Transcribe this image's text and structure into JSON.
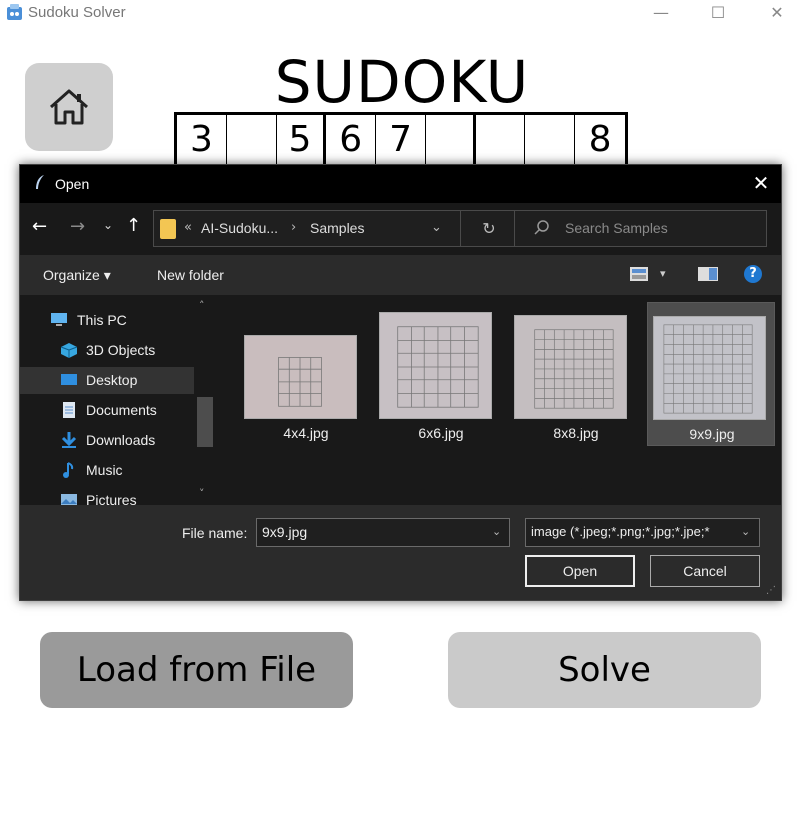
{
  "window": {
    "title": "Sudoku Solver",
    "minimize_glyph": "—",
    "maximize_glyph": "☐",
    "close_glyph": "✕"
  },
  "app": {
    "heading": "SUDOKU",
    "grid_row": [
      "3",
      "",
      "5",
      "6",
      "7",
      "",
      "",
      "",
      "8"
    ],
    "load_button": "Load from File",
    "solve_button": "Solve"
  },
  "dialog": {
    "title": "Open",
    "close_glyph": "✕",
    "nav": {
      "back_glyph": "←",
      "forward_glyph": "→",
      "recent_glyph": "⌄",
      "up_glyph": "↑"
    },
    "address": {
      "overflow_glyph": "«",
      "segment1": "AI-Sudoku...",
      "separator": "›",
      "segment2": "Samples",
      "dropdown_glyph": "⌄",
      "refresh_glyph": "↻"
    },
    "search": {
      "placeholder": "Search Samples"
    },
    "toolbar": {
      "organize": "Organize ▾",
      "new_folder": "New folder",
      "view_dropdown": "▾",
      "help": "?"
    },
    "nav_pane": {
      "items": [
        {
          "label": "This PC",
          "icon": "pc-icon"
        },
        {
          "label": "3D Objects",
          "icon": "cube-icon"
        },
        {
          "label": "Desktop",
          "icon": "desktop-icon",
          "selected": true
        },
        {
          "label": "Documents",
          "icon": "document-icon"
        },
        {
          "label": "Downloads",
          "icon": "download-icon"
        },
        {
          "label": "Music",
          "icon": "music-icon"
        },
        {
          "label": "Pictures",
          "icon": "pictures-icon"
        }
      ],
      "scroll_up": "˄",
      "scroll_down": "˅"
    },
    "files": [
      {
        "name": "4x4.jpg"
      },
      {
        "name": "6x6.jpg"
      },
      {
        "name": "8x8.jpg"
      },
      {
        "name": "9x9.jpg",
        "selected": true
      }
    ],
    "file_name_label": "File name:",
    "file_name_value": "9x9.jpg",
    "file_name_dropdown": "⌄",
    "file_type": "image (*.jpeg;*.png;*.jpg;*.jpe;*",
    "file_type_dropdown": "⌄",
    "open_button": "Open",
    "cancel_button": "Cancel",
    "resize_grip": "⋰"
  },
  "colors": {
    "dialog_bg": "#2b2b2b",
    "pane_bg": "#191919",
    "titlebar_bg": "#000000",
    "help_blue": "#1f78d1",
    "folder_yellow": "#f3c653",
    "load_button_bg": "#9a9a9a",
    "solve_button_bg": "#cacaca",
    "home_button_bg": "#cfcfcf"
  }
}
